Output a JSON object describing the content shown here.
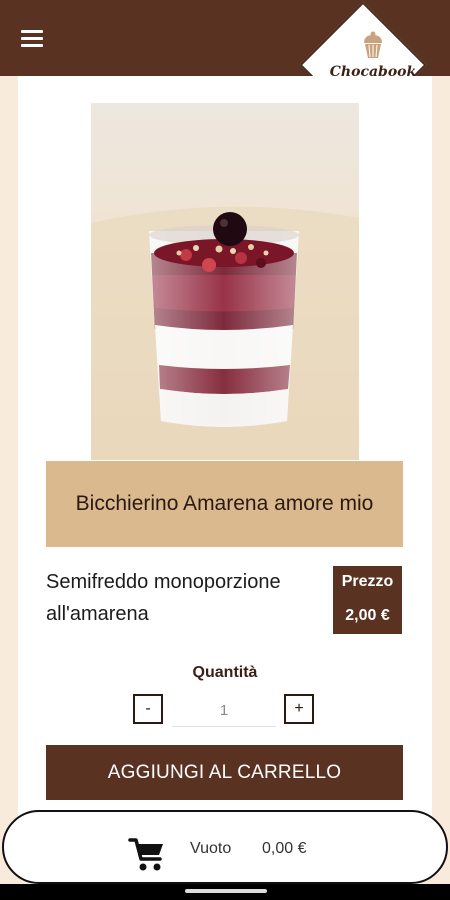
{
  "app": {
    "brand": "Chocabook",
    "menu_icon": "hamburger-menu-icon",
    "logo_icon": "cupcake-icon"
  },
  "product": {
    "title": "Bicchierino Amarena amore mio",
    "description": "Semifreddo monoporzione all'amarena",
    "price_label": "Prezzo",
    "price_value": "2,00 €"
  },
  "quantity": {
    "label": "Quantità",
    "minus_label": "-",
    "plus_label": "+",
    "value": "1"
  },
  "actions": {
    "add_to_cart": "AGGIUNGI AL CARRELLO"
  },
  "cart": {
    "icon": "cart-icon",
    "status": "Vuoto",
    "total": "0,00 €"
  },
  "colors": {
    "brand_dark": "#5a3222",
    "banner": "#dab98e",
    "page_background": "#f8ebdc"
  }
}
